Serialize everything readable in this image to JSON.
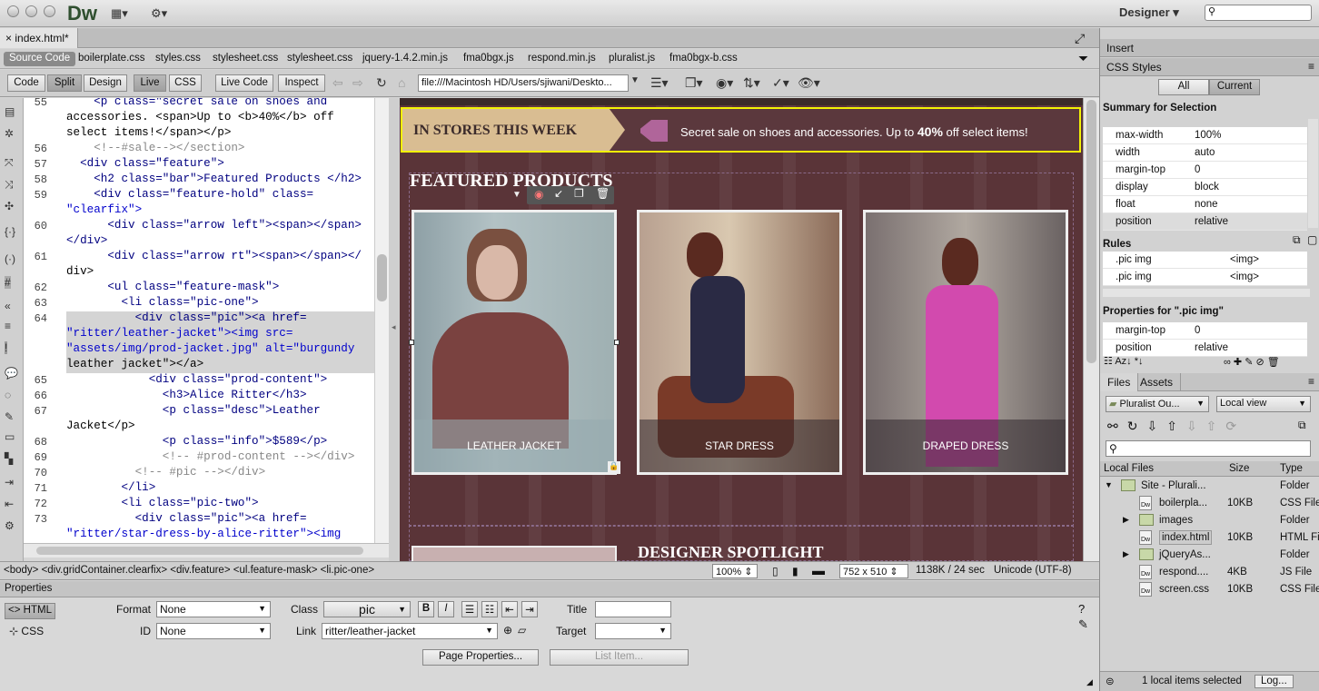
{
  "app": {
    "logo": "Dw",
    "workspace": "Designer",
    "search_placeholder": ""
  },
  "doc": {
    "tab": "index.html*",
    "close": "×"
  },
  "related_files": [
    "Source Code",
    "boilerplate.css",
    "styles.css",
    "stylesheet.css",
    "stylesheet.css",
    "jquery-1.4.2.min.js",
    "fma0bgx.js",
    "respond.min.js",
    "pluralist.js",
    "fma0bgx-b.css"
  ],
  "view_buttons": {
    "code": "Code",
    "split": "Split",
    "design": "Design",
    "live": "Live",
    "css": "CSS",
    "live_code": "Live Code",
    "inspect": "Inspect"
  },
  "address": "file:///Macintosh HD/Users/sjiwani/Deskto...",
  "code_lines": [
    {
      "n": "55",
      "t": "    <p class=\"secret sale on shoes and"
    },
    {
      "n": "",
      "t": "accessories. <span>Up to <b>40%</b> off"
    },
    {
      "n": "",
      "t": "select items!</span></p>"
    },
    {
      "n": "56",
      "t": "    <!--#sale--></section>"
    },
    {
      "n": "57",
      "t": "  <div class=\"feature\">"
    },
    {
      "n": "58",
      "t": "    <h2 class=\"bar\">Featured Products </h2>"
    },
    {
      "n": "59",
      "t": "    <div class=\"feature-hold\" class="
    },
    {
      "n": "",
      "t": "\"clearfix\">"
    },
    {
      "n": "60",
      "t": "      <div class=\"arrow left\"><span></span>"
    },
    {
      "n": "",
      "t": "</div>"
    },
    {
      "n": "61",
      "t": "      <div class=\"arrow rt\"><span></span></"
    },
    {
      "n": "",
      "t": "div>"
    },
    {
      "n": "62",
      "t": "      <ul class=\"feature-mask\">"
    },
    {
      "n": "63",
      "t": "        <li class=\"pic-one\">"
    },
    {
      "n": "64",
      "t": "          <div class=\"pic\"><a href="
    },
    {
      "n": "",
      "t": "\"ritter/leather-jacket\"><img src="
    },
    {
      "n": "",
      "t": "\"assets/img/prod-jacket.jpg\" alt=\"burgundy"
    },
    {
      "n": "",
      "t": "leather jacket\"></a>"
    },
    {
      "n": "65",
      "t": "            <div class=\"prod-content\">"
    },
    {
      "n": "66",
      "t": "              <h3>Alice Ritter</h3>"
    },
    {
      "n": "67",
      "t": "              <p class=\"desc\">Leather"
    },
    {
      "n": "",
      "t": "Jacket</p>"
    },
    {
      "n": "68",
      "t": "              <p class=\"info\">$589</p>"
    },
    {
      "n": "69",
      "t": "              <!-- #prod-content --></div>"
    },
    {
      "n": "70",
      "t": "          <!-- #pic --></div>"
    },
    {
      "n": "71",
      "t": "        </li>"
    },
    {
      "n": "72",
      "t": "        <li class=\"pic-two\">"
    },
    {
      "n": "73",
      "t": "          <div class=\"pic\"><a href="
    },
    {
      "n": "",
      "t": "\"ritter/star-dress-by-alice-ritter\"><img"
    }
  ],
  "live": {
    "banner_title": "IN STORES THIS WEEK",
    "banner_text_a": "Secret sale on shoes and accessories. Up to ",
    "banner_text_b": "40%",
    "banner_text_c": " off select items!",
    "featured_title": "FEATURED PRODUCTS",
    "cards": [
      "LEATHER JACKET",
      "STAR DRESS",
      "DRAPED DRESS"
    ],
    "spotlight": "DESIGNER SPOTLIGHT"
  },
  "status": {
    "tags": "<body> <div.gridContainer.clearfix> <div.feature> <ul.feature-mask> <li.pic-one>",
    "zoom": "100%",
    "size": "752 x 510",
    "weight": "1138K / 24 sec",
    "encoding": "Unicode (UTF-8)"
  },
  "properties": {
    "title": "Properties",
    "html": "HTML",
    "css": "CSS",
    "format_label": "Format",
    "format_value": "None",
    "id_label": "ID",
    "id_value": "None",
    "class_label": "Class",
    "class_value": "pic",
    "link_label": "Link",
    "link_value": "ritter/leather-jacket",
    "title_label": "Title",
    "target_label": "Target",
    "page_props": "Page Properties...",
    "list_item": "List Item..."
  },
  "css_panel": {
    "insert": "Insert",
    "css_styles": "CSS Styles",
    "all": "All",
    "current": "Current",
    "summary": "Summary for Selection",
    "summary_rows": [
      [
        "max-width",
        "100%"
      ],
      [
        "width",
        "auto"
      ],
      [
        "margin-top",
        "0"
      ],
      [
        "display",
        "block"
      ],
      [
        "float",
        "none"
      ],
      [
        "position",
        "relative"
      ]
    ],
    "rules_label": "Rules",
    "rules": [
      [
        ".pic img",
        "<img>"
      ],
      [
        ".pic img",
        "<img>"
      ]
    ],
    "props_label": "Properties for \".pic img\"",
    "prop_rows": [
      [
        "margin-top",
        "0"
      ],
      [
        "position",
        "relative"
      ]
    ]
  },
  "files_panel": {
    "files": "Files",
    "assets": "Assets",
    "site": "Pluralist Ou...",
    "view": "Local view",
    "col_name": "Local Files",
    "col_size": "Size",
    "col_type": "Type",
    "rows": [
      {
        "name": "Site - Plurali...",
        "size": "",
        "type": "Folder",
        "kind": "folder",
        "indent": 0
      },
      {
        "name": "boilerpla...",
        "size": "10KB",
        "type": "CSS File",
        "kind": "file",
        "indent": 1
      },
      {
        "name": "images",
        "size": "",
        "type": "Folder",
        "kind": "folder",
        "indent": 1
      },
      {
        "name": "index.html",
        "size": "10KB",
        "type": "HTML Fi",
        "kind": "file",
        "indent": 1
      },
      {
        "name": "jQueryAs...",
        "size": "",
        "type": "Folder",
        "kind": "folder",
        "indent": 1
      },
      {
        "name": "respond....",
        "size": "4KB",
        "type": "JS File",
        "kind": "file",
        "indent": 1
      },
      {
        "name": "screen.css",
        "size": "10KB",
        "type": "CSS File",
        "kind": "file",
        "indent": 1
      }
    ],
    "footer": "1 local items selected",
    "log": "Log..."
  }
}
